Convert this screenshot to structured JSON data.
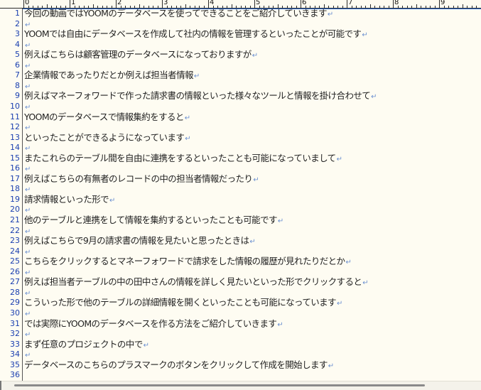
{
  "ruler": {
    "labels": [
      "0",
      "1",
      "2",
      "3",
      "4",
      "5",
      "6",
      "7",
      "8",
      "9"
    ]
  },
  "editor": {
    "return_mark": "↵",
    "lines": [
      {
        "n": "1",
        "text": "今回の動画ではYOOMのデータベースを使ってできることをご紹介していきます"
      },
      {
        "n": "2",
        "text": ""
      },
      {
        "n": "3",
        "text": "YOOMでは自由にデータベースを作成して社内の情報を管理するといったことが可能です"
      },
      {
        "n": "4",
        "text": ""
      },
      {
        "n": "5",
        "text": "例えばこちらは顧客管理のデータベースになっておりますが"
      },
      {
        "n": "6",
        "text": ""
      },
      {
        "n": "7",
        "text": "企業情報であったりだとか例えば担当者情報"
      },
      {
        "n": "8",
        "text": ""
      },
      {
        "n": "9",
        "text": "例えばマネーフォワードで作った請求書の情報といった様々なツールと情報を掛け合わせて"
      },
      {
        "n": "10",
        "text": ""
      },
      {
        "n": "11",
        "text": "YOOMのデータベースで情報集約をすると"
      },
      {
        "n": "12",
        "text": ""
      },
      {
        "n": "13",
        "text": "といったことができるようになっています"
      },
      {
        "n": "14",
        "text": ""
      },
      {
        "n": "15",
        "text": "またこれらのテーブル間を自由に連携をするといったことも可能になっていまして"
      },
      {
        "n": "16",
        "text": ""
      },
      {
        "n": "17",
        "text": "例えばこちらの有無者のレコードの中の担当者情報だったり"
      },
      {
        "n": "18",
        "text": ""
      },
      {
        "n": "19",
        "text": "請求情報といった形で"
      },
      {
        "n": "20",
        "text": ""
      },
      {
        "n": "21",
        "text": "他のテーブルと連携をして情報を集約するといったことも可能です"
      },
      {
        "n": "22",
        "text": ""
      },
      {
        "n": "23",
        "text": "例えばこちらで9月の請求書の情報を見たいと思ったときは"
      },
      {
        "n": "24",
        "text": ""
      },
      {
        "n": "25",
        "text": "こちらをクリックするとマネーフォワードで請求をした情報の履歴が見れたりだとか"
      },
      {
        "n": "26",
        "text": ""
      },
      {
        "n": "27",
        "text": "例えば担当者テーブルの中の田中さんの情報を詳しく見たいといった形でクリックすると"
      },
      {
        "n": "28",
        "text": ""
      },
      {
        "n": "29",
        "text": "こういった形で他のテーブルの詳細情報を開くといったことも可能になっています"
      },
      {
        "n": "30",
        "text": ""
      },
      {
        "n": "31",
        "text": "では実際にYOOMのデータベースを作る方法をご紹介していきます"
      },
      {
        "n": "32",
        "text": ""
      },
      {
        "n": "33",
        "text": "まず任意のプロジェクトの中で"
      },
      {
        "n": "34",
        "text": ""
      },
      {
        "n": "35",
        "text": "データベースのこちらのプラスマークのボタンをクリックして作成を開始します"
      },
      {
        "n": "36",
        "text": ""
      }
    ]
  }
}
